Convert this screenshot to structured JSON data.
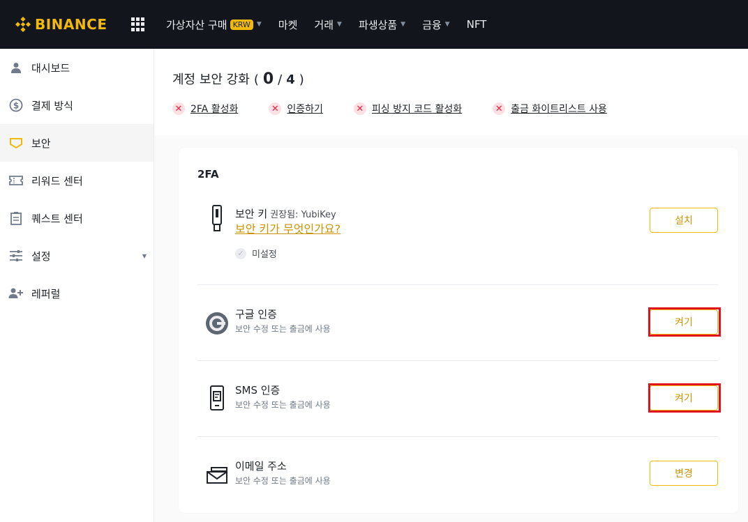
{
  "brand": {
    "name": "BINANCE",
    "color": "#f0b90b"
  },
  "topnav": {
    "items": [
      {
        "label": "가상자산 구매",
        "badge": "KRW",
        "has_caret": true
      },
      {
        "label": "마켓",
        "has_caret": false
      },
      {
        "label": "거래",
        "has_caret": true
      },
      {
        "label": "파생상품",
        "has_caret": true
      },
      {
        "label": "금융",
        "has_caret": true
      },
      {
        "label": "NFT",
        "has_caret": false
      }
    ]
  },
  "sidebar": {
    "items": [
      {
        "label": "대시보드",
        "icon": "user-icon",
        "active": false
      },
      {
        "label": "결제 방식",
        "icon": "dollar-circle-icon",
        "active": false
      },
      {
        "label": "보안",
        "icon": "shield-icon",
        "active": true
      },
      {
        "label": "리워드 센터",
        "icon": "ticket-icon",
        "active": false
      },
      {
        "label": "퀘스트 센터",
        "icon": "clipboard-icon",
        "active": false
      },
      {
        "label": "설정",
        "icon": "sliders-icon",
        "active": false,
        "has_caret": true
      },
      {
        "label": "레퍼럴",
        "icon": "add-user-icon",
        "active": false
      }
    ]
  },
  "security_header": {
    "title": "계정 보안 강화",
    "open_paren": "(",
    "done": "0",
    "slash": "/",
    "total": "4",
    "close_paren": ")",
    "checklist": [
      "2FA 활성화",
      "인증하기",
      "피싱 방지 코드 활성화",
      "출금 화이트리스트 사용"
    ]
  },
  "twofa": {
    "section_title": "2FA",
    "security_key": {
      "title": "보안 키",
      "hint": "권장됨: YubiKey",
      "link": "보안 키가 무엇인가요?",
      "status": "미설정",
      "button": "설치"
    },
    "google": {
      "title": "구글 인증",
      "subtitle": "보안 수정 또는 출금에 사용",
      "button": "켜기"
    },
    "sms": {
      "title": "SMS 인증",
      "subtitle": "보안 수정 또는 출금에 사용",
      "button": "켜기"
    },
    "email": {
      "title": "이메일 주소",
      "subtitle": "보안 수정 또는 출금에 사용",
      "button": "변경"
    }
  },
  "colors": {
    "accent": "#f0b90b",
    "link": "#c99400",
    "error": "#e0263f",
    "highlight": "#e0141e",
    "nav_bg": "#12161c"
  }
}
